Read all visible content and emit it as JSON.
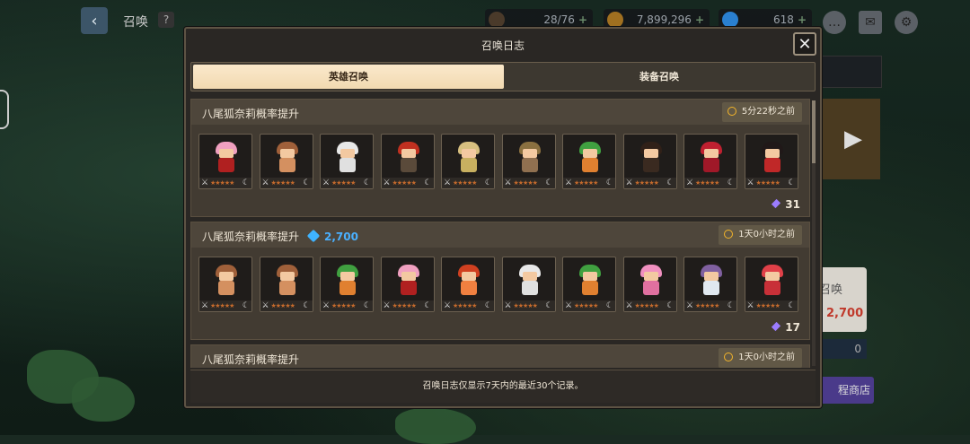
{
  "header": {
    "back_icon": "back-arrow-icon",
    "title": "召唤",
    "help_label": "?"
  },
  "resources": [
    {
      "name": "stamina-icon",
      "value": "28/76"
    },
    {
      "name": "gold-coin-icon",
      "value": "7,899,296"
    },
    {
      "name": "gem-icon",
      "value": "618"
    }
  ],
  "top_icons": [
    "chat-icon",
    "mail-icon",
    "settings-icon"
  ],
  "background_panel": {
    "summon_label": "召唤",
    "price": "2,700",
    "bar_value": "0",
    "shop_label": "程商店"
  },
  "modal": {
    "title": "召唤日志",
    "tabs": [
      {
        "label": "英雄召唤",
        "active": true
      },
      {
        "label": "装备召唤",
        "active": false
      }
    ],
    "entries": [
      {
        "title": "八尾狐奈莉概率提升",
        "cost": "",
        "time": "5分22秒之前",
        "count": "31",
        "heroes": [
          {
            "hair": "#f0a0c0",
            "body": "#b02020"
          },
          {
            "hair": "#a0603a",
            "body": "#d49060"
          },
          {
            "hair": "#e8e8e8",
            "body": "#e0e0e0"
          },
          {
            "hair": "#c03020",
            "body": "#5a4a3a"
          },
          {
            "hair": "#d8c080",
            "body": "#c8b060"
          },
          {
            "hair": "#8a7040",
            "body": "#907050"
          },
          {
            "hair": "#40a040",
            "body": "#e08030"
          },
          {
            "hair": "#302018",
            "body": "#3a2a20"
          },
          {
            "hair": "#c02030",
            "body": "#a01828"
          },
          {
            "hair": "#201818",
            "body": "#c02828"
          }
        ]
      },
      {
        "title": "八尾狐奈莉概率提升",
        "cost": "2,700",
        "time": "1天0小时之前",
        "count": "17",
        "heroes": [
          {
            "hair": "#a0603a",
            "body": "#d49060"
          },
          {
            "hair": "#a0603a",
            "body": "#d49060"
          },
          {
            "hair": "#40a040",
            "body": "#e08030"
          },
          {
            "hair": "#f0a0c0",
            "body": "#b02020"
          },
          {
            "hair": "#d04020",
            "body": "#f08040"
          },
          {
            "hair": "#e8e8e8",
            "body": "#e0e0e0"
          },
          {
            "hair": "#40a040",
            "body": "#e08030"
          },
          {
            "hair": "#f090c0",
            "body": "#e070a0"
          },
          {
            "hair": "#8060a0",
            "body": "#e0e8f0"
          },
          {
            "hair": "#e04048",
            "body": "#c83038"
          }
        ]
      },
      {
        "title": "八尾狐奈莉概率提升",
        "cost": "",
        "time": "1天0小时之前",
        "count": "",
        "heroes": []
      }
    ],
    "footer_note": "召唤日志仅显示7天内的最近30个记录。"
  }
}
